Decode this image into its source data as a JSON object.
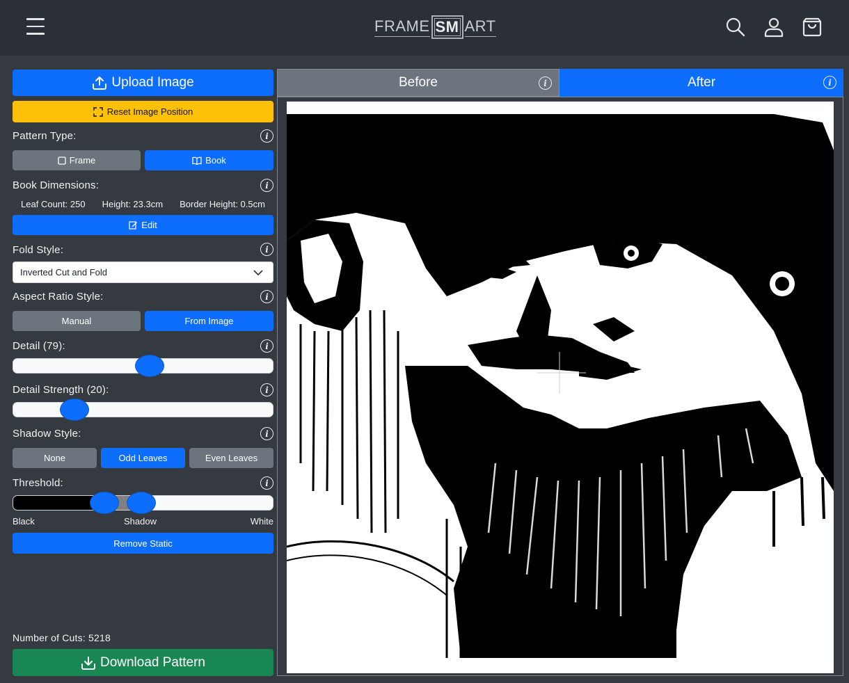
{
  "header": {
    "logo_left": "FRAME",
    "logo_box": "SM",
    "logo_right": "ART",
    "icons": [
      "hamburger-menu-icon",
      "search-icon",
      "user-icon",
      "cart-icon"
    ]
  },
  "sidebar": {
    "upload_label": "Upload Image",
    "reset_label": "Reset Image Position",
    "pattern_type": {
      "label": "Pattern Type:",
      "options": [
        "Frame",
        "Book"
      ],
      "selected": "Book"
    },
    "book_dimensions": {
      "label": "Book Dimensions:",
      "leaf_count": "Leaf Count: 250",
      "height": "Height: 23.3cm",
      "border_height": "Border Height: 0.5cm",
      "edit_label": "Edit"
    },
    "fold_style": {
      "label": "Fold Style:",
      "value": "Inverted Cut and Fold"
    },
    "aspect_ratio": {
      "label": "Aspect Ratio Style:",
      "options": [
        "Manual",
        "From Image"
      ],
      "selected": "From Image"
    },
    "detail": {
      "label": "Detail (79):",
      "value": 79,
      "min": 0,
      "max": 150
    },
    "detail_strength": {
      "label": "Detail Strength (20):",
      "value": 20,
      "min": 0,
      "max": 100
    },
    "shadow_style": {
      "label": "Shadow Style:",
      "options": [
        "None",
        "Odd Leaves",
        "Even Leaves"
      ],
      "selected": "Odd Leaves"
    },
    "threshold": {
      "label": "Threshold:",
      "low_fraction": 0.33,
      "high_fraction": 0.49,
      "black_label": "Black",
      "shadow_label": "Shadow",
      "white_label": "White"
    },
    "remove_static_label": "Remove Static",
    "cuts": "Number of Cuts: 5218",
    "download_label": "Download Pattern"
  },
  "preview": {
    "tabs": [
      "Before",
      "After"
    ],
    "active_tab": "After",
    "image_description_icon": "portrait-preview-image"
  },
  "colors": {
    "primary": "#0d6efd",
    "secondary": "#6c757d",
    "warning": "#ffc107",
    "success": "#198754",
    "background": "#343a40",
    "header": "#2b3038"
  }
}
